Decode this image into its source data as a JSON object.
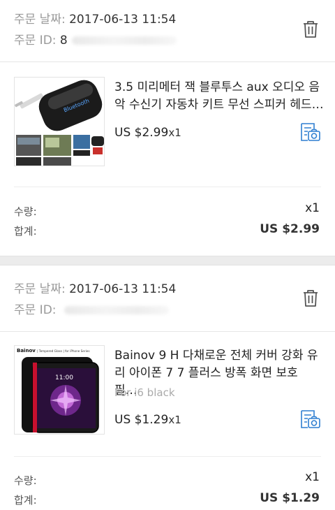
{
  "orders": [
    {
      "date_label": "주문 날짜:",
      "date_value": "2017-06-13 11:54",
      "id_label": "주문 ID:",
      "id_value_visible": "8",
      "id_value_tail": "",
      "product": {
        "title": "3.5 미리메터 잭 블루투스 aux 오디오 음악 수신기 자동차 키트 무선 스피커 헤드…",
        "variant": "",
        "price": "US $2.99",
        "qty_suffix": "x1",
        "thumb_text": "Bluetooth"
      },
      "qty_label": "수량:",
      "qty_value": "x1",
      "total_label": "합계:",
      "total_value": "US $2.99"
    },
    {
      "date_label": "주문 날짜:",
      "date_value": "2017-06-13 11:54",
      "id_label": "주문 ID:",
      "id_value_visible": "",
      "id_value_tail": "",
      "product": {
        "title": "Bainov 9 H 다채로운 전체 커버 강화 유리 아이폰 7 7 플러스 방폭 화면 보호 필…",
        "variant": "For i6 black",
        "price": "US $1.29",
        "qty_suffix": "x1",
        "thumb_brand": "Bainov",
        "thumb_caption": "| Tempered Glass | for iPhone Series",
        "thumb_time": "11:00"
      },
      "qty_label": "수량:",
      "qty_value": "x1",
      "total_label": "합계:",
      "total_value": "US $1.29"
    }
  ],
  "icons": {
    "trash": "trash-icon",
    "camera": "photo-review-icon"
  },
  "colors": {
    "accent_icon": "#2f7fd1",
    "label_gray": "#9a9a9a",
    "separator": "#ececec"
  }
}
